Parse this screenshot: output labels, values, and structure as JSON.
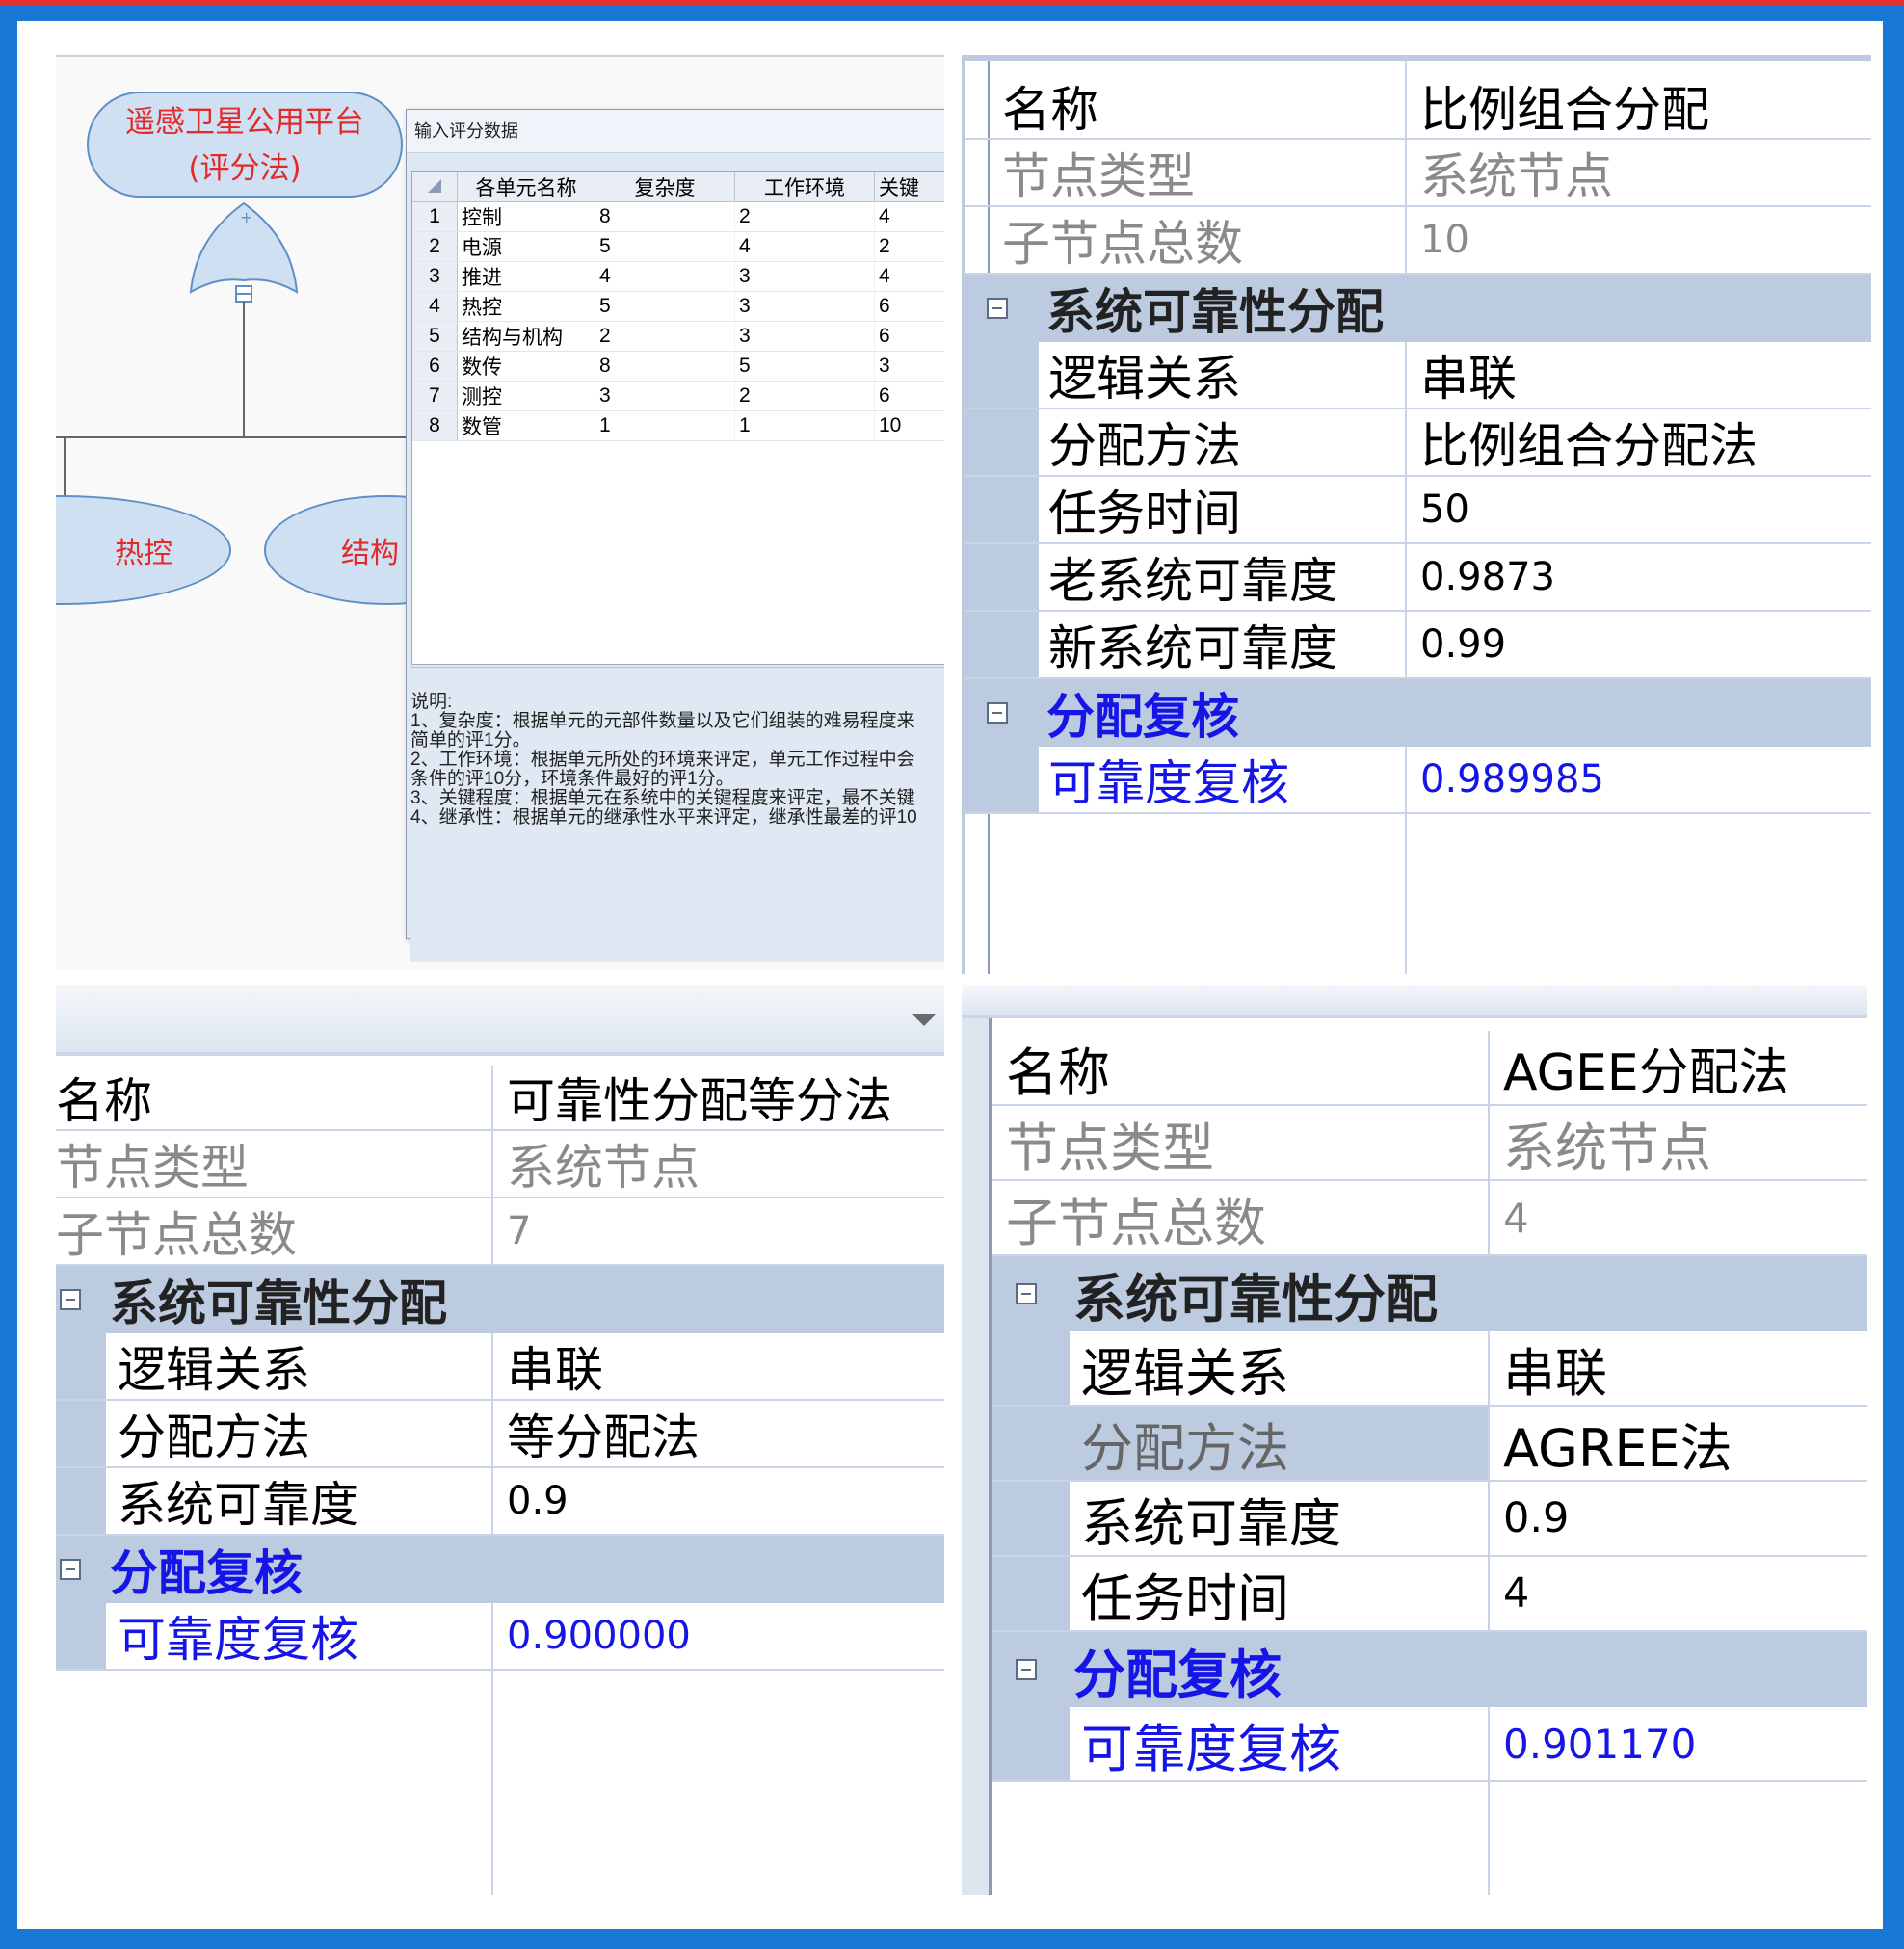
{
  "tree": {
    "root_label": "遥感卫星公用平台",
    "root_sub": "(评分法)",
    "gate_plus": "+",
    "child1": "热控",
    "child2": "结构"
  },
  "dialog": {
    "title": "输入评分数据",
    "columns": [
      "各单元名称",
      "复杂度",
      "工作环境",
      "关键"
    ],
    "rows": [
      [
        "1",
        "控制",
        "8",
        "2",
        "4"
      ],
      [
        "2",
        "电源",
        "5",
        "4",
        "2"
      ],
      [
        "3",
        "推进",
        "4",
        "3",
        "4"
      ],
      [
        "4",
        "热控",
        "5",
        "3",
        "6"
      ],
      [
        "5",
        "结构与机构",
        "2",
        "3",
        "6"
      ],
      [
        "6",
        "数传",
        "8",
        "5",
        "3"
      ],
      [
        "7",
        "测控",
        "3",
        "2",
        "6"
      ],
      [
        "8",
        "数管",
        "1",
        "1",
        "10"
      ]
    ],
    "notes": [
      "说明:",
      "1、复杂度：根据单元的元部件数量以及它们组装的难易程度来",
      "简单的评1分。",
      "2、工作环境：根据单元所处的环境来评定，单元工作过程中会",
      "条件的评10分，环境条件最好的评1分。",
      "3、关键程度：根据单元在系统中的关键程度来评定，最不关键",
      "4、继承性：根据单元的继承性水平来评定，继承性最差的评10"
    ]
  },
  "panel_tr": {
    "name_label": "名称",
    "name_value": "比例组合分配",
    "type_label": "节点类型",
    "type_value": "系统节点",
    "children_label": "子节点总数",
    "children_value": "10",
    "cat1": "系统可靠性分配",
    "props": [
      {
        "k": "逻辑关系",
        "v": "串联"
      },
      {
        "k": "分配方法",
        "v": "比例组合分配法"
      },
      {
        "k": "任务时间",
        "v": "50"
      },
      {
        "k": "老系统可靠度",
        "v": "0.9873"
      },
      {
        "k": "新系统可靠度",
        "v": "0.99"
      }
    ],
    "cat2": "分配复核",
    "check_label": "可靠度复核",
    "check_value": "0.989985"
  },
  "panel_bl": {
    "dropdown_icon": "chevron-down-icon",
    "name_label": "名称",
    "name_value": "可靠性分配等分法",
    "type_label": "节点类型",
    "type_value": "系统节点",
    "children_label": "子节点总数",
    "children_value": "7",
    "cat1": "系统可靠性分配",
    "props": [
      {
        "k": "逻辑关系",
        "v": "串联"
      },
      {
        "k": "分配方法",
        "v": "等分配法"
      },
      {
        "k": "系统可靠度",
        "v": "0.9"
      }
    ],
    "cat2": "分配复核",
    "check_label": "可靠度复核",
    "check_value": "0.900000"
  },
  "panel_br": {
    "name_label": "名称",
    "name_value": "AGEE分配法",
    "type_label": "节点类型",
    "type_value": "系统节点",
    "children_label": "子节点总数",
    "children_value": "4",
    "cat1": "系统可靠性分配",
    "props": [
      {
        "k": "逻辑关系",
        "v": "串联"
      },
      {
        "k": "分配方法",
        "v": "AGREE法"
      },
      {
        "k": "系统可靠度",
        "v": "0.9"
      },
      {
        "k": "任务时间",
        "v": "4"
      }
    ],
    "cat2": "分配复核",
    "check_label": "可靠度复核",
    "check_value": "0.901170"
  }
}
